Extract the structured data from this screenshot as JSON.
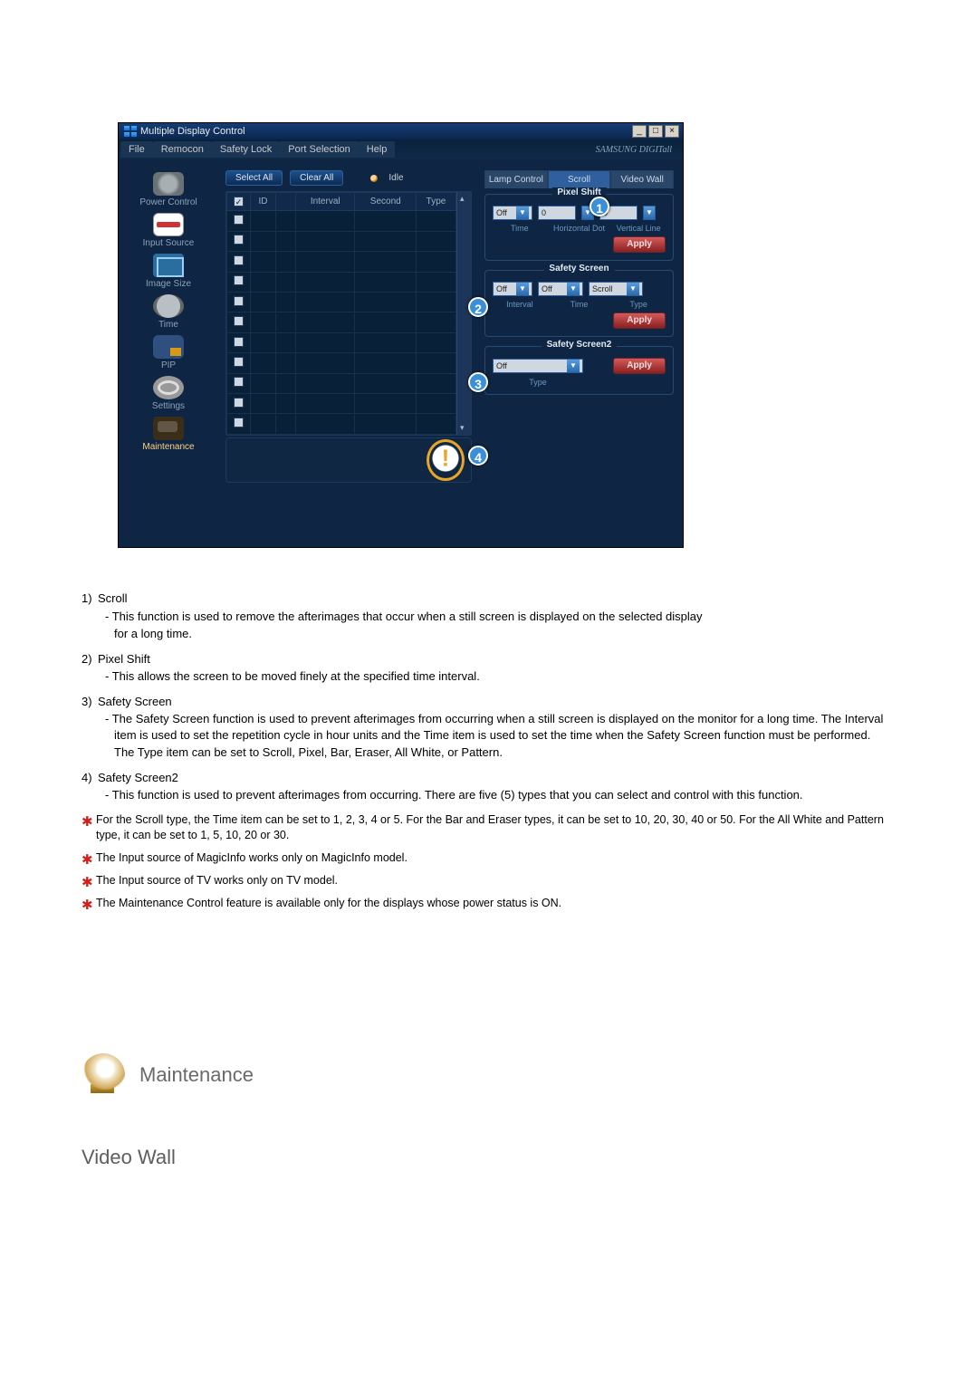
{
  "window": {
    "title": "Multiple Display Control",
    "brand": "SAMSUNG DIGITall",
    "menus": [
      "File",
      "Remocon",
      "Safety Lock",
      "Port Selection",
      "Help"
    ]
  },
  "sidebar": {
    "items": [
      {
        "label": "Power Control"
      },
      {
        "label": "Input Source"
      },
      {
        "label": "Image Size"
      },
      {
        "label": "Time"
      },
      {
        "label": "PIP"
      },
      {
        "label": "Settings"
      },
      {
        "label": "Maintenance"
      }
    ],
    "activeIndex": 6
  },
  "toolbar": {
    "select_all": "Select All",
    "clear_all": "Clear All",
    "idle_label": "Idle"
  },
  "grid": {
    "headers": [
      "",
      "ID",
      "",
      "Interval",
      "Second",
      "Type"
    ],
    "rowCount": 11
  },
  "tabs": {
    "items": [
      "Lamp Control",
      "Scroll",
      "Video Wall"
    ],
    "activeIndex": 1
  },
  "pixel_shift": {
    "legend": "Pixel Shift",
    "time_value": "Off",
    "h_value": "0",
    "v_value": "0",
    "time_label": "Time",
    "h_label": "Horizontal Dot",
    "v_label": "Vertical Line",
    "apply": "Apply"
  },
  "safety_screen": {
    "legend": "Safety Screen",
    "interval_value": "Off",
    "time_value": "Off",
    "type_value": "Scroll",
    "interval_label": "Interval",
    "time_label": "Time",
    "type_label": "Type",
    "apply": "Apply"
  },
  "safety_screen2": {
    "legend": "Safety Screen2",
    "type_value": "Off",
    "type_label": "Type",
    "apply": "Apply"
  },
  "badges": {
    "b1": "1",
    "b2": "2",
    "b3": "3",
    "b4": "4"
  },
  "doc": {
    "items": [
      {
        "num": "1)",
        "title": "Scroll",
        "lines": [
          "This function is used to remove the afterimages that occur when a still screen is displayed on the selected display",
          "for a long time."
        ]
      },
      {
        "num": "2)",
        "title": "Pixel Shift",
        "lines": [
          "This allows the screen to be moved finely at the specified time interval."
        ]
      },
      {
        "num": "3)",
        "title": "Safety Screen",
        "lines": [
          "The Safety Screen function is used to prevent afterimages from occurring when a still screen is displayed on the monitor for a long time.  The Interval item is used to set the repetition cycle in hour units and the Time item is used to set the time when the Safety Screen function must be performed.",
          "The Type item can be set to Scroll, Pixel, Bar, Eraser, All White, or Pattern."
        ]
      },
      {
        "num": "4)",
        "title": "Safety Screen2",
        "lines": [
          "This function is used to prevent afterimages from occurring. There are five (5) types that you can select and control with this function."
        ]
      }
    ],
    "stars": [
      "For the Scroll type, the Time item can be set to 1, 2, 3, 4 or 5. For the Bar and Eraser types, it can be set to 10, 20, 30, 40 or 50. For the All White and Pattern type, it can be set to 1, 5, 10, 20 or 30.",
      "The Input source of MagicInfo works only on MagicInfo model.",
      "The Input source of TV works only on TV model.",
      "The Maintenance Control feature is available only for the displays whose power status is ON."
    ]
  },
  "section": {
    "heading": "Maintenance",
    "subheading": "Video Wall"
  }
}
